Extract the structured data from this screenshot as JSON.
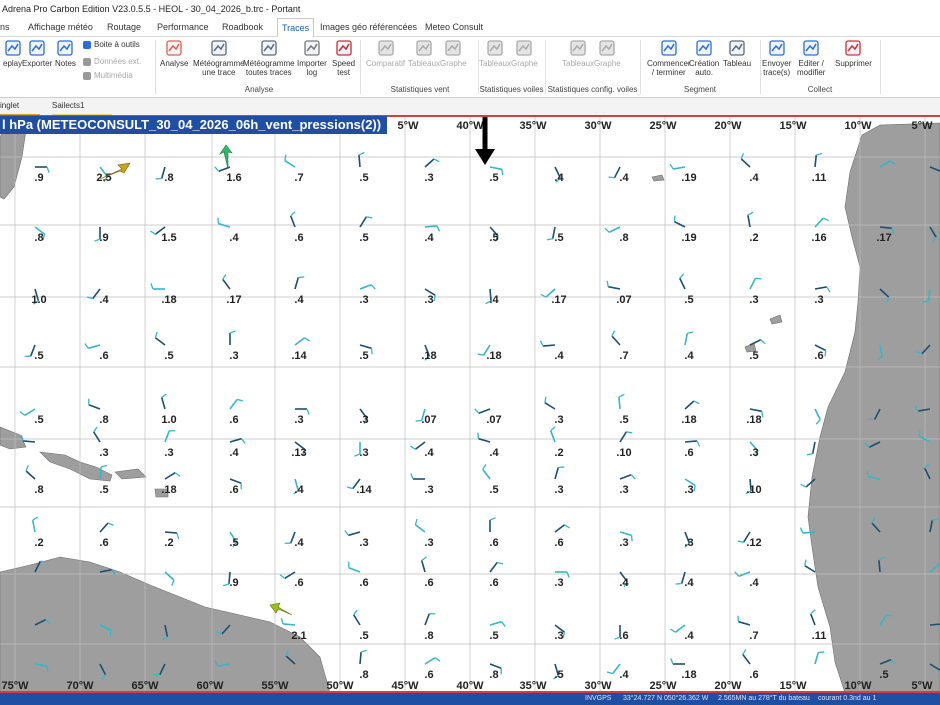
{
  "window": {
    "title": "Adrena Pro Carbon Edition V23.0.5.5 - HEOL - 30_04_2026_b.trc - Portant"
  },
  "tabs": [
    "ns",
    "Affichage météo",
    "Routage",
    "Performance",
    "Roadbook",
    "Traces",
    "Images géo référencées",
    "Meteo Consult"
  ],
  "active_tab": "Traces",
  "ribbon": {
    "buttons": [
      {
        "id": "replay",
        "label": "eplay",
        "sub": "",
        "disabled": false
      },
      {
        "id": "exporter",
        "label": "Exporter",
        "sub": "",
        "disabled": false
      },
      {
        "id": "notes",
        "label": "Notes",
        "sub": "",
        "disabled": false
      },
      {
        "id": "boite",
        "label": "Boite à outils",
        "sub": "",
        "disabled": false
      },
      {
        "id": "donnees",
        "label": "Données ext.",
        "sub": "",
        "disabled": true
      },
      {
        "id": "multimedia",
        "label": "Multimédia",
        "sub": "",
        "disabled": true
      },
      {
        "id": "analyse",
        "label": "Analyse",
        "sub": "",
        "disabled": false
      },
      {
        "id": "meteo1",
        "label": "Météogramme",
        "sub": "une trace",
        "disabled": false
      },
      {
        "id": "meteo2",
        "label": "Météogramme",
        "sub": "toutes traces",
        "disabled": false
      },
      {
        "id": "importer",
        "label": "Importer",
        "sub": "log",
        "disabled": false
      },
      {
        "id": "speed",
        "label": "Speed",
        "sub": "test",
        "disabled": false
      },
      {
        "id": "comparatif",
        "label": "Comparatif",
        "sub": "",
        "disabled": true
      },
      {
        "id": "tableaux1",
        "label": "Tableaux",
        "sub": "",
        "disabled": true
      },
      {
        "id": "graphe1",
        "label": "Graphe",
        "sub": "",
        "disabled": true
      },
      {
        "id": "tableaux2",
        "label": "Tableaux",
        "sub": "",
        "disabled": true
      },
      {
        "id": "graphe2",
        "label": "Graphe",
        "sub": "",
        "disabled": true
      },
      {
        "id": "tableaux3",
        "label": "Tableaux",
        "sub": "",
        "disabled": true
      },
      {
        "id": "graphe3",
        "label": "Graphe",
        "sub": "",
        "disabled": true
      },
      {
        "id": "commencer",
        "label": "Commencer",
        "sub": "/ terminer",
        "disabled": false
      },
      {
        "id": "creation",
        "label": "Création",
        "sub": "auto.",
        "disabled": false
      },
      {
        "id": "tableau",
        "label": "Tableau",
        "sub": "",
        "disabled": false
      },
      {
        "id": "envoyer",
        "label": "Envoyer",
        "sub": "trace(s)",
        "disabled": false
      },
      {
        "id": "editer",
        "label": "Editer /",
        "sub": "modifier",
        "disabled": false
      },
      {
        "id": "supprimer",
        "label": "Supprimer",
        "sub": "",
        "disabled": false
      }
    ],
    "groups": [
      "Analyse",
      "Statistiques vent",
      "Statistiques voiles",
      "Statistiques config. voiles",
      "Segment",
      "Collect"
    ]
  },
  "doc_tabs": [
    "inglet",
    "Sailects1"
  ],
  "map": {
    "layer_name": "l hPa (METEOCONSULT_30_04_2026_06h_vent_pressions(2))",
    "top_lon_labels": [
      "5°W",
      "40°W",
      "35°W",
      "30°W",
      "25°W",
      "20°W",
      "15°W",
      "10°W",
      "5°W"
    ],
    "bottom_lon_labels": [
      "75°W",
      "70°W",
      "65°W",
      "60°W",
      "55°W",
      "50°W",
      "45°W",
      "40°W",
      "35°W",
      "30°W",
      "25°W",
      "20°W",
      "15°W",
      "10°W",
      "5°W"
    ],
    "grid_labels": [
      [
        ".9",
        "2.5",
        ".8",
        "1.6",
        ".7",
        ".5",
        ".3",
        ".5",
        ".4",
        ".4",
        ".19",
        ".4",
        ".11",
        "",
        ""
      ],
      [
        ".8",
        ".9",
        "1.5",
        ".4",
        ".6",
        ".5",
        ".4",
        ".5",
        ".5",
        ".8",
        ".19",
        ".2",
        ".16",
        ".17",
        ""
      ],
      [
        "1.0",
        ".4",
        ".18",
        ".17",
        ".4",
        ".3",
        ".3",
        ".4",
        ".17",
        ".07",
        ".5",
        ".3",
        ".3",
        "",
        ""
      ],
      [
        ".5",
        ".6",
        ".5",
        ".3",
        ".14",
        ".5",
        ".18",
        ".18",
        ".4",
        ".7",
        ".4",
        ".5",
        ".6",
        "",
        ""
      ],
      [
        ".5",
        ".8",
        "1.0",
        ".6",
        ".3",
        ".3",
        ".07",
        ".07",
        ".3",
        ".5",
        ".18",
        ".18",
        "",
        "",
        ""
      ],
      [
        "",
        ".3",
        ".3",
        ".4",
        ".13",
        ".3",
        ".4",
        ".4",
        ".2",
        ".10",
        ".6",
        ".3",
        "",
        "",
        ""
      ],
      [
        ".8",
        ".5",
        ".18",
        ".6",
        ".4",
        ".14",
        ".3",
        ".5",
        ".3",
        ".3",
        ".3",
        ".10",
        "",
        "",
        ""
      ],
      [
        ".2",
        ".6",
        ".2",
        ".5",
        ".4",
        ".3",
        ".3",
        ".6",
        ".6",
        ".3",
        ".3",
        ".12",
        "",
        "",
        ""
      ],
      [
        "",
        "",
        "",
        ".9",
        ".6",
        ".6",
        ".6",
        ".6",
        ".3",
        ".4",
        ".4",
        ".4",
        "",
        "",
        ""
      ],
      [
        "",
        "",
        "",
        "",
        "2.1",
        ".5",
        ".8",
        ".5",
        ".3",
        ".6",
        ".4",
        ".7",
        ".11",
        "",
        ""
      ],
      [
        "",
        "",
        "",
        "",
        "",
        ".8",
        ".6",
        ".8",
        ".5",
        ".4",
        ".18",
        ".6",
        "",
        ".5",
        ""
      ]
    ]
  },
  "status": {
    "items": [
      "INVGPS",
      "33°24.727 N  050°26.362 W",
      "2.565MN au 278°T du bateau",
      "courant 0.3nd au 1"
    ]
  },
  "colors": {
    "accent": "#1f4fa3",
    "land": "#9e9e9e",
    "map_border": "#d04040",
    "arrow_dark": "#1d4f6e",
    "arrow_light": "#35b6c9",
    "arrow_green": "#2fb86a"
  }
}
